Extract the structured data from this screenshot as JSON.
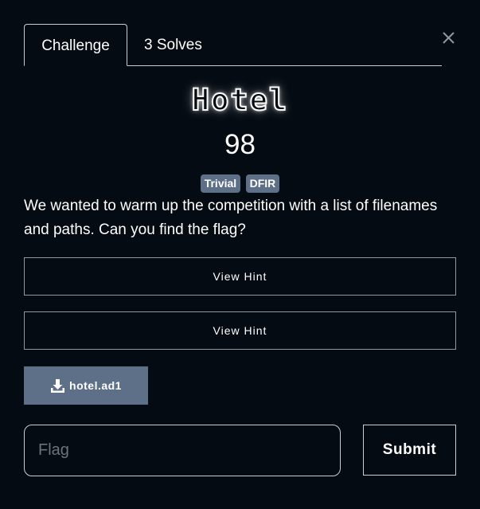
{
  "tabs": {
    "challenge_label": "Challenge",
    "solves_label": "3 Solves"
  },
  "challenge": {
    "name": "Hotel",
    "value": "98",
    "tags": [
      "Trivial",
      "DFIR"
    ],
    "description": "We wanted to warm up the competition with a list of filenames and paths. Can you find the flag?"
  },
  "hints": [
    {
      "label": "View Hint"
    },
    {
      "label": "View Hint"
    }
  ],
  "file": {
    "name": "hotel.ad1",
    "icon": "download-icon"
  },
  "flag_form": {
    "placeholder": "Flag",
    "value": "",
    "submit_label": "Submit"
  },
  "icons": {
    "close": "close-icon"
  },
  "colors": {
    "background": "#050b12",
    "tag": "#5d7088",
    "file_button": "#5d7088",
    "border": "#c9ced4"
  }
}
